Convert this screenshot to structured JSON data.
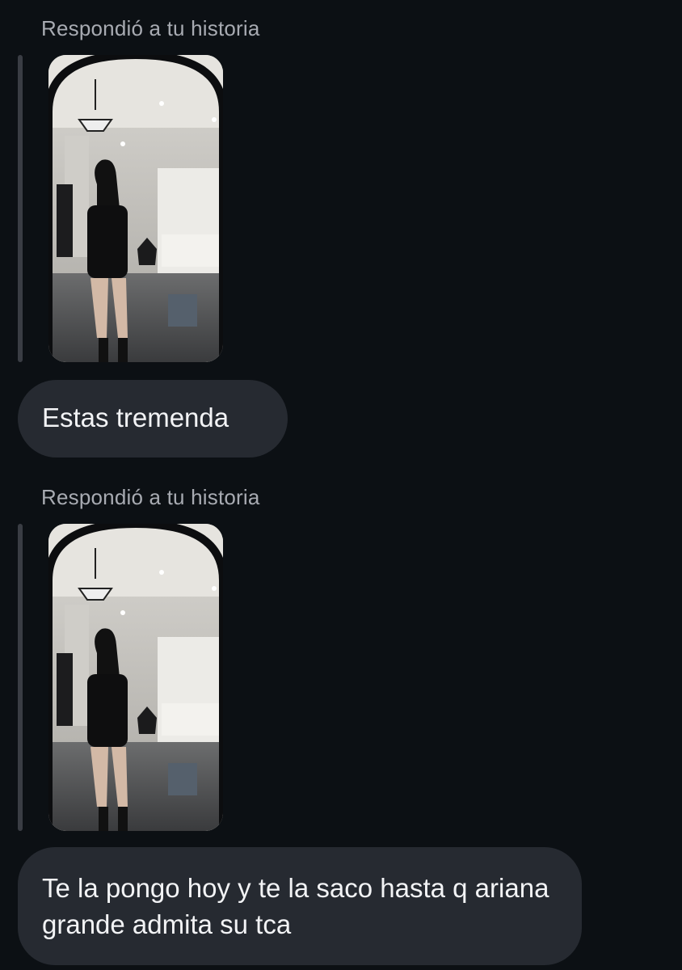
{
  "thread": {
    "messages": [
      {
        "reply_label": "Respondió a tu historia",
        "story_preview_icon": "story-mirror-selfie-thumbnail",
        "text": "Estas tremenda"
      },
      {
        "reply_label": "Respondió a tu historia",
        "story_preview_icon": "story-mirror-selfie-thumbnail",
        "text": "Te la pongo hoy y te la saco hasta q ariana grande admita su tca"
      }
    ]
  },
  "theme": {
    "background": "#0c1014",
    "bubble": "#262a31",
    "label_text": "#a8abb2",
    "message_text": "#f2f3f5",
    "quote_bar": "#3a3d44"
  }
}
